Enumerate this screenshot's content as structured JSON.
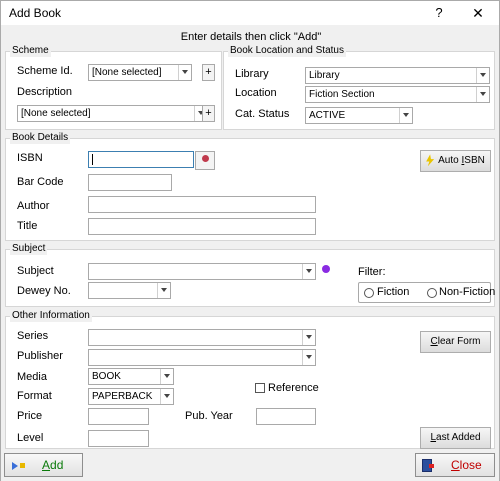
{
  "window": {
    "title": "Add Book",
    "help": "?",
    "close": "✕"
  },
  "instructions": "Enter details then click \"Add\"",
  "scheme": {
    "title": "Scheme",
    "scheme_id_label": "Scheme Id.",
    "scheme_id_value": "[None selected]",
    "description_label": "Description",
    "description_value": "[None selected]",
    "plus": "+"
  },
  "location": {
    "title": "Book Location and Status",
    "library_label": "Library",
    "library_value": "Library",
    "location_label": "Location",
    "location_value": "Fiction Section",
    "status_label": "Cat. Status",
    "status_value": "ACTIVE"
  },
  "book_details": {
    "title": "Book Details",
    "isbn_label": "ISBN",
    "isbn_value": "",
    "barcode_label": "Bar Code",
    "author_label": "Author",
    "title_label": "Title",
    "auto_isbn_prefix": "Auto ",
    "auto_isbn_key": "I",
    "auto_isbn_suffix": "SBN",
    "auto_isbn_icon_color": "#e8c400"
  },
  "subject": {
    "title": "Subject",
    "subject_label": "Subject",
    "dewey_label": "Dewey No.",
    "filter_label": "Filter:",
    "fiction_label": "Fiction",
    "nonfiction_label": "Non-Fiction"
  },
  "other": {
    "title": "Other Information",
    "series_label": "Series",
    "publisher_label": "Publisher",
    "media_label": "Media",
    "media_value": "BOOK",
    "format_label": "Format",
    "format_value": "PAPERBACK",
    "reference_label": "Reference",
    "price_label": "Price",
    "pub_year_label": "Pub. Year",
    "level_label": "Level",
    "clear_key": "C",
    "clear_rest": "lear Form",
    "last_key": "L",
    "last_rest": "ast Added"
  },
  "footer": {
    "add_key": "A",
    "add_rest": "dd",
    "close_key": "C",
    "close_rest": "lose",
    "add_color": "#0a7a0a",
    "close_color": "#c00000"
  }
}
